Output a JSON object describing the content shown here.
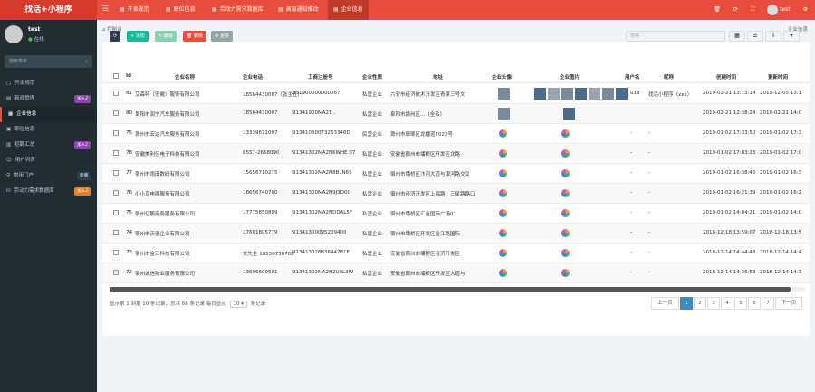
{
  "app": {
    "logo": "找活+小程序"
  },
  "topbar": {
    "tabs": [
      {
        "label": "开发规范"
      },
      {
        "label": "职位信息"
      },
      {
        "label": "劳动力需求数据库"
      },
      {
        "label": "高层通知推动"
      },
      {
        "label": "企业信息"
      }
    ],
    "user": "test"
  },
  "sidebar": {
    "user": "test",
    "status": "在线",
    "search_placeholder": "搜索菜单",
    "items": [
      {
        "label": "开发规范",
        "badge": ""
      },
      {
        "label": "新闻管理",
        "badge": "加入2"
      },
      {
        "label": "企业信息",
        "badge": ""
      },
      {
        "label": "职位信息",
        "badge": ""
      },
      {
        "label": "招聘汇总",
        "badge": "加入2"
      },
      {
        "label": "用户列表",
        "badge": ""
      },
      {
        "label": "常用门户",
        "badge": "新增"
      },
      {
        "label": "劳动力需求数据库",
        "badge": "加入2"
      }
    ]
  },
  "main": {
    "breadcrumb": "控制台",
    "breadcrumb_right": "企业信息",
    "toolbar": {
      "refresh": "⟳",
      "add": "+ 添加",
      "edit": "✎ 编辑",
      "delete": "🗑 删除",
      "more": "⚙ 更多",
      "search_placeholder": "搜索"
    },
    "table": {
      "headers": [
        "Id",
        "企业名称",
        "企业电话",
        "工商注册号",
        "企业性质",
        "地址",
        "企业头像",
        "企业图片",
        "用户名",
        "昵称",
        "创建时间",
        "更新时间"
      ],
      "rows": [
        {
          "id": "81",
          "name": "艾森特（安徽）服饰有限公司",
          "phone": "18564430007（张主任）",
          "reg": "331900000000067",
          "nature": "私营企业",
          "address": "六安市经济技术开发区青泉三号文",
          "user": "u18",
          "nick": "找活小程序（xxx）",
          "created": "2019-02-21 13:13:14",
          "updated": "2019-12-05 13:1"
        },
        {
          "id": "80",
          "name": "阜阳市润宁汽车服务有限公司",
          "phone": "18564430007",
          "reg": "91341900MA2T...",
          "nature": "私营企业",
          "address": "阜阳市颍州区...（全名）",
          "user": "",
          "nick": "",
          "created": "2019-02-21 12:38:24",
          "updated": "2019-02-21 14:0"
        },
        {
          "id": "75",
          "name": "滁州市宏达汽车服务有限公司",
          "phone": "13339671007",
          "reg": "91341050073263346D",
          "nature": "民营企业",
          "address": "滁州市琅琊区龙蟠道7022号",
          "user": "-",
          "nick": "-",
          "created": "2019-01-02 17:33:50",
          "updated": "2019-01-02 17:3"
        },
        {
          "id": "78",
          "name": "安徽美利佳电子科技有限公司",
          "phone": "0557-2668090",
          "reg": "91341302MA2NKWHE 07",
          "nature": "私营企业",
          "address": "安徽省宿州市埇桥区开发区北路",
          "user": "-",
          "nick": "-",
          "created": "2019-01-02 17:03:23",
          "updated": "2019-01-02 17:0"
        },
        {
          "id": "77",
          "name": "宿州市雨田数码有限公司",
          "phone": "15656710275",
          "reg": "91341302MA2N8BLN65",
          "nature": "私营企业",
          "address": "宿州市埇桥区汴河大道与银河路交叉",
          "user": "-",
          "nick": "-",
          "created": "2019-01-02 16:38:45",
          "updated": "2019-01-02 16:3"
        },
        {
          "id": "76",
          "name": "小小鸟电器服务有限公司",
          "phone": "18656740700",
          "reg": "91341300MA2N9J3D00",
          "nature": "私营企业",
          "address": "宿州市经济开发区上海路、三星路路口",
          "user": "-",
          "nick": "-",
          "created": "2019-01-02 16:21:39",
          "updated": "2019-01-02 16:2"
        },
        {
          "id": "75",
          "name": "宿州亿鹏商务服务有限公司",
          "phone": "17775850809",
          "reg": "91341302MA2NDDAL5F",
          "nature": "私营企业",
          "address": "宿州市埇桥区汇金国际广场01",
          "user": "-",
          "nick": "-",
          "created": "2019-01-02 14:04:21",
          "updated": "2019-01-02 14:0"
        },
        {
          "id": "74",
          "name": "宿州市沃德企业有限公司",
          "phone": "17601805779",
          "reg": "91341300095209400",
          "nature": "私营企业",
          "address": "宿州市埇桥区开发区金江路国际",
          "user": "-",
          "nick": "-",
          "created": "2018-12-18 13:59:07",
          "updated": "2018-12-18 13:5"
        },
        {
          "id": "73",
          "name": "宿州市金江科技有限公司",
          "phone": "文先生 18156730708",
          "reg": "91341302683644781F",
          "nature": "私营企业",
          "address": "安徽省宿州市埇桥区经济开发区",
          "user": "-",
          "nick": "-",
          "created": "2018-12-14 14:44:48",
          "updated": "2018-12-14 14:4"
        },
        {
          "id": "72",
          "name": "宿州诚信物业服务有限公司",
          "phone": "13696600501",
          "reg": "91341302MA2N2U6L3W",
          "nature": "私营企业",
          "address": "安徽省宿州市埇桥区开发区大道与",
          "user": "-",
          "nick": "-",
          "created": "2018-12-14 14:36:53",
          "updated": "2018-12-14 14:3"
        }
      ]
    },
    "footer": {
      "info_prefix": "显示第 1 到第 10 条记录，总共 66 条记录 每页显示",
      "per_page": "10",
      "info_suffix": "条记录",
      "prev": "上一页",
      "pages": [
        "1",
        "2",
        "3",
        "4",
        "5",
        "6",
        "7"
      ],
      "next": "下一页"
    }
  },
  "colors": {
    "brand": "#e74c3c",
    "sidebar_bg": "#222d32",
    "add": "#18bc9c",
    "edit": "#8ecfb6",
    "delete": "#e74c3c",
    "more": "#95a5a6",
    "refresh": "#2c3e50"
  }
}
